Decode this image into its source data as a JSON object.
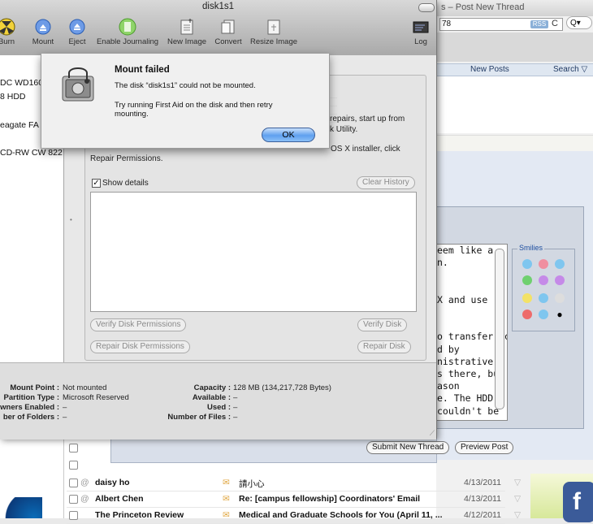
{
  "window": {
    "title": "disk1s1"
  },
  "toolbar": {
    "items": [
      {
        "label": "Burn"
      },
      {
        "label": "Mount"
      },
      {
        "label": "Eject"
      },
      {
        "label": "Enable Journaling"
      },
      {
        "label": "New Image"
      },
      {
        "label": "Convert"
      },
      {
        "label": "Resize Image"
      },
      {
        "label": "Log"
      }
    ]
  },
  "sidebar": {
    "items": [
      "DC WD160",
      "8 HDD",
      "eagate FA (",
      "CD-RW CW 822"
    ]
  },
  "alert": {
    "title": "Mount failed",
    "message": "The disk “disk1s1” could not be mounted.",
    "detail": "Try running First Aid on the disk and then retry mounting.",
    "ok_label": "OK"
  },
  "first_aid": {
    "line_repairs": "repairs, start up from",
    "line_utility": "k Utility.",
    "line_installer": "OS X installer, click",
    "line_repair_perms": "Repair Permissions.",
    "show_details_label": "Show details",
    "show_details_checked": true,
    "clear_history_label": "Clear History",
    "verify_perms_label": "Verify Disk Permissions",
    "verify_disk_label": "Verify Disk",
    "repair_perms_label": "Repair Disk Permissions",
    "repair_disk_label": "Repair Disk"
  },
  "info": {
    "mount_point_label": "Mount Point :",
    "mount_point_value": "Not mounted",
    "partition_type_label": "Partition Type :",
    "partition_type_value": "Microsoft Reserved",
    "owners_label": "wners Enabled :",
    "owners_value": "–",
    "folders_label": "ber of Folders :",
    "folders_value": "–",
    "capacity_label": "Capacity :",
    "capacity_value": "128 MB (134,217,728 Bytes)",
    "available_label": "Available :",
    "available_value": "–",
    "used_label": "Used :",
    "used_value": "–",
    "files_label": "Number of Files :",
    "files_value": "–"
  },
  "browser": {
    "title": "s – Post New Thread",
    "address": "78",
    "rss": "RSS",
    "reload": "C",
    "search": "Q▾",
    "nav": {
      "new_posts": "New Posts",
      "search": "Search ▽"
    },
    "textarea_lines": [
      "eem like a",
      "n.",
      "",
      "",
      "X and use",
      "",
      "",
      "o transfer to",
      "d by",
      "nistrative",
      "s there, but",
      "ason",
      "e. The HDD",
      "couldn't be"
    ],
    "smilies_label": "Smilies",
    "submit_label": "Submit New Thread",
    "preview_label": "Preview Post"
  },
  "mail": {
    "rows": [
      {
        "sender": "daisy ho",
        "subject": "請小心",
        "date": "4/13/2011"
      },
      {
        "sender": "Albert Chen",
        "subject": "Re: [campus fellowship] Coordinators' Email",
        "date": "4/13/2011"
      },
      {
        "sender": "The Princeton Review",
        "subject": "Medical and Graduate Schools for You (April 11, ...",
        "date": "4/12/2011"
      }
    ]
  }
}
